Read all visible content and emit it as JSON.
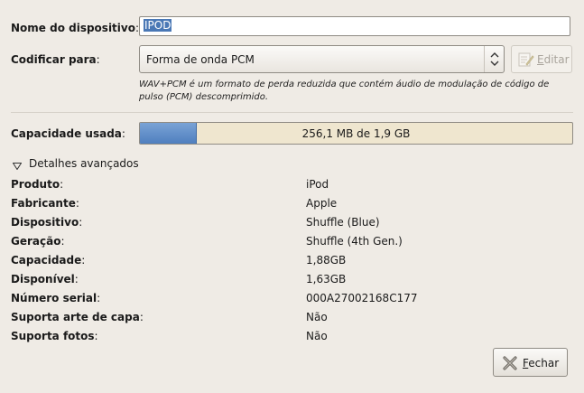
{
  "form": {
    "device_name_label": "Nome do dispositivo",
    "device_name_value": "IPOD",
    "encode_label": "Codificar para",
    "encode_value": "Forma de onda PCM",
    "edit_button": "Editar",
    "encode_hint": "WAV+PCM é um formato de perda reduzida que contém áudio de modulação de código de pulso (PCM) descomprimido.",
    "capacity_label": "Capacidade usada",
    "capacity_text": "256,1 MB de 1,9 GB",
    "capacity_used_fraction": 0.13
  },
  "advanced": {
    "expander_label": "Detalhes avançados",
    "rows": [
      {
        "label": "Produto",
        "value": "iPod"
      },
      {
        "label": "Fabricante",
        "value": "Apple"
      },
      {
        "label": "Dispositivo",
        "value": "Shuffle (Blue)"
      },
      {
        "label": "Geração",
        "value": "Shuffle (4th Gen.)"
      },
      {
        "label": "Capacidade",
        "value": "1,88GB"
      },
      {
        "label": "Disponível",
        "value": "1,63GB"
      },
      {
        "label": "Número serial",
        "value": "000A27002168C177"
      },
      {
        "label": "Suporta arte de capa",
        "value": "Não"
      },
      {
        "label": "Suporta fotos",
        "value": "Não"
      }
    ]
  },
  "footer": {
    "close_button": "Fechar"
  },
  "icons": {
    "combo_arrows": "up-down-arrows-icon",
    "edit": "edit-document-icon",
    "expander": "triangle-down-icon",
    "close": "close-x-icon"
  }
}
